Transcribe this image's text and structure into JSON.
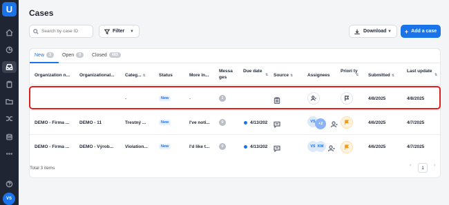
{
  "app": {
    "logo_text": "U",
    "avatar_initials": "VS"
  },
  "page": {
    "title": "Cases"
  },
  "search": {
    "placeholder": "Search by case ID"
  },
  "toolbar": {
    "filter_label": "Filter",
    "download_label": "Download",
    "add_label": "Add a case"
  },
  "tabs": [
    {
      "label": "New",
      "count": "3"
    },
    {
      "label": "Open",
      "count": "0"
    },
    {
      "label": "Closed",
      "count": "483"
    }
  ],
  "columns": [
    "Organization n...",
    "Organizational...",
    "Categ...",
    "Status",
    "More in...",
    "Messa ges",
    "Due date",
    "Source",
    "Assignees",
    "Priori ty",
    "Submitted",
    "Last update"
  ],
  "rows": [
    {
      "org": "",
      "unit": "",
      "category": "-",
      "status": "New",
      "more": "-",
      "messages": "1",
      "due": "",
      "source": "form",
      "assignees": [],
      "priority": "none",
      "submitted": "4/8/2025",
      "last_update": "4/8/2025"
    },
    {
      "org": "DEMO - Firma ...",
      "unit": "DEMO - 11",
      "category": "Trestný ...",
      "status": "New",
      "more": "I've noti...",
      "messages": "0",
      "due": "4/13/202",
      "source": "chat",
      "assignees": [
        "VS",
        "+2"
      ],
      "priority": "high",
      "submitted": "4/6/2025",
      "last_update": "4/7/2025"
    },
    {
      "org": "DEMO - Firma ...",
      "unit": "DEMO - Výrob...",
      "category": "Violation...",
      "status": "New",
      "more": "I'd like t...",
      "messages": "0",
      "due": "4/13/202",
      "source": "chat",
      "assignees": [
        "VS",
        "KM"
      ],
      "priority": "high",
      "submitted": "4/6/2025",
      "last_update": "4/7/2025"
    }
  ],
  "footer": {
    "total": "Total 3 items",
    "page": "1"
  },
  "colors": {
    "accent": "#1a73e8",
    "highlight": "#e01e1e",
    "priority": "#f39c12"
  }
}
